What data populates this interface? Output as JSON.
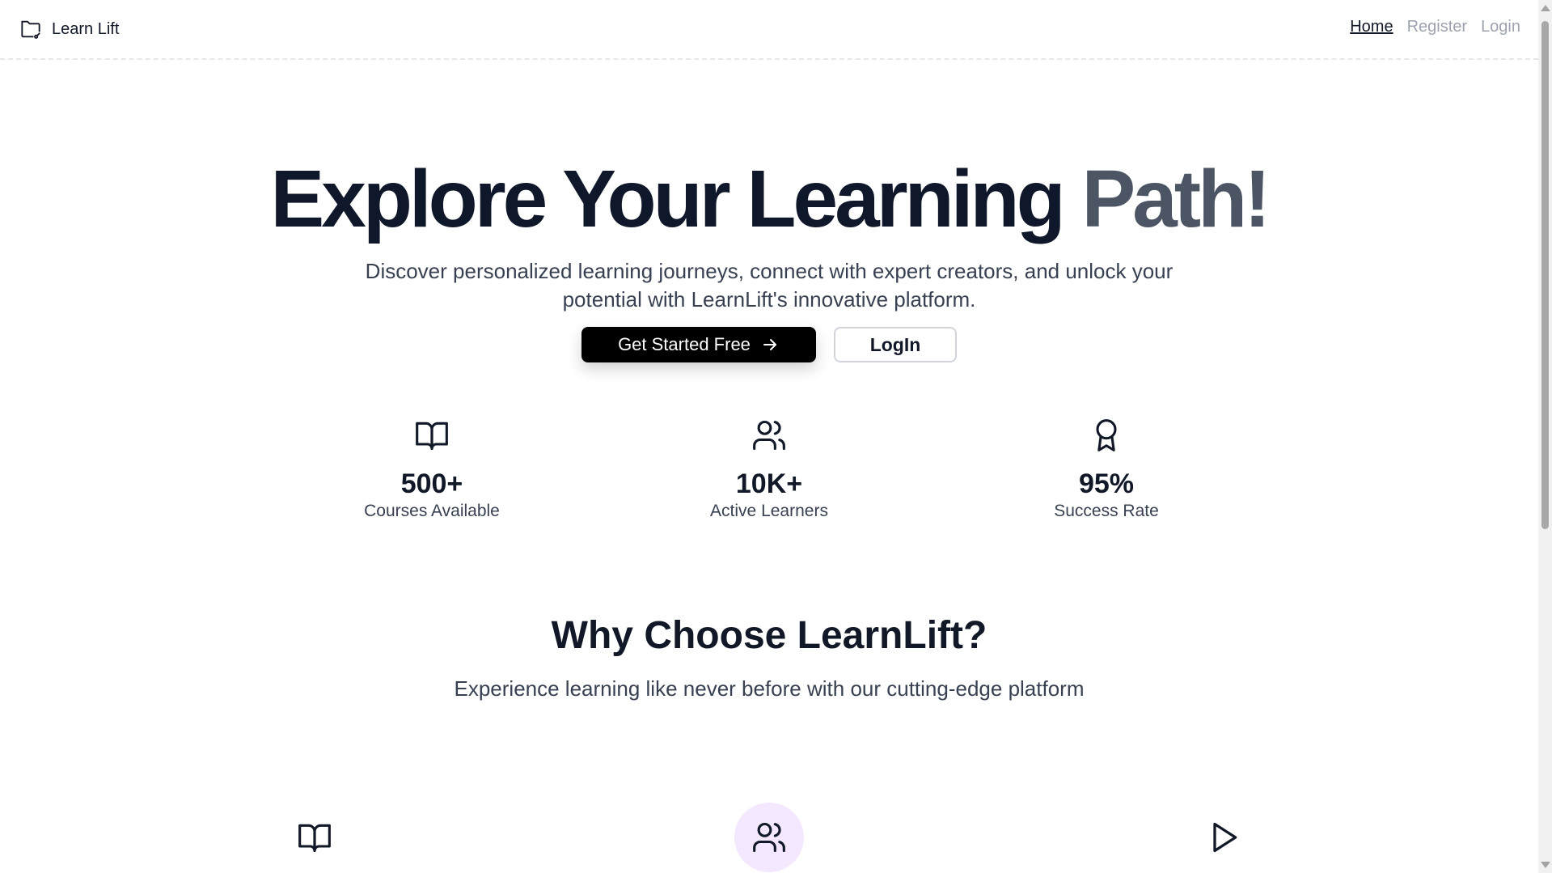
{
  "header": {
    "brand": "Learn Lift",
    "nav": [
      "Home",
      "Register",
      "Login"
    ]
  },
  "hero": {
    "title_part1": "Explore Your ",
    "title_part2": "Learning ",
    "title_part3": "Path!",
    "subtitle": "Discover personalized learning journeys, connect with expert creators, and unlock your potential with LearnLift's innovative platform.",
    "primary_button": "Get Started Free",
    "secondary_button": "LogIn"
  },
  "stats": [
    {
      "icon": "book-open-icon",
      "value": "500+",
      "label": "Courses Available"
    },
    {
      "icon": "users-icon",
      "value": "10K+",
      "label": "Active Learners"
    },
    {
      "icon": "award-icon",
      "value": "95%",
      "label": "Success Rate"
    }
  ],
  "why": {
    "title": "Why Choose LearnLift?",
    "subtitle": "Experience learning like never before with our cutting-edge platform"
  },
  "features": [
    {
      "icon": "book-open-icon"
    },
    {
      "icon": "users-icon",
      "highlight_color": "#f3e8ff"
    },
    {
      "icon": "play-icon"
    }
  ]
}
